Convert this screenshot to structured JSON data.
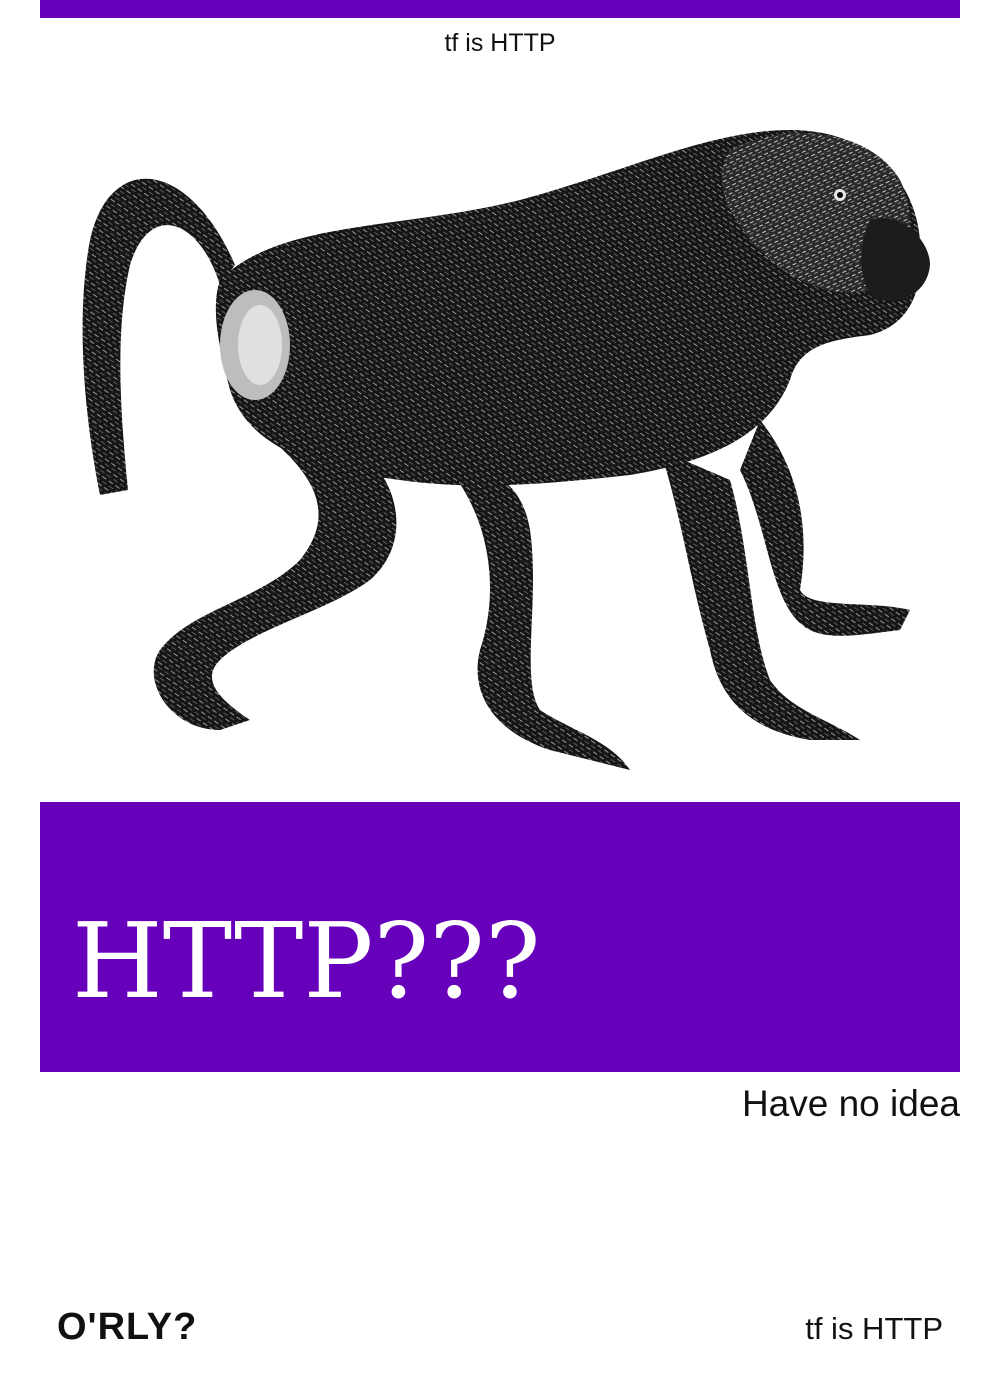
{
  "colors": {
    "accent": "#6600bb",
    "background": "#ffffff",
    "text": "#111111",
    "title_text": "#ffffff"
  },
  "cover": {
    "top_tagline": "tf is HTTP",
    "title": "HTTP???",
    "subtitle": "Have no idea",
    "publisher": "O'RLY?",
    "author": "tf is HTTP",
    "illustration": "baboon-engraving"
  }
}
